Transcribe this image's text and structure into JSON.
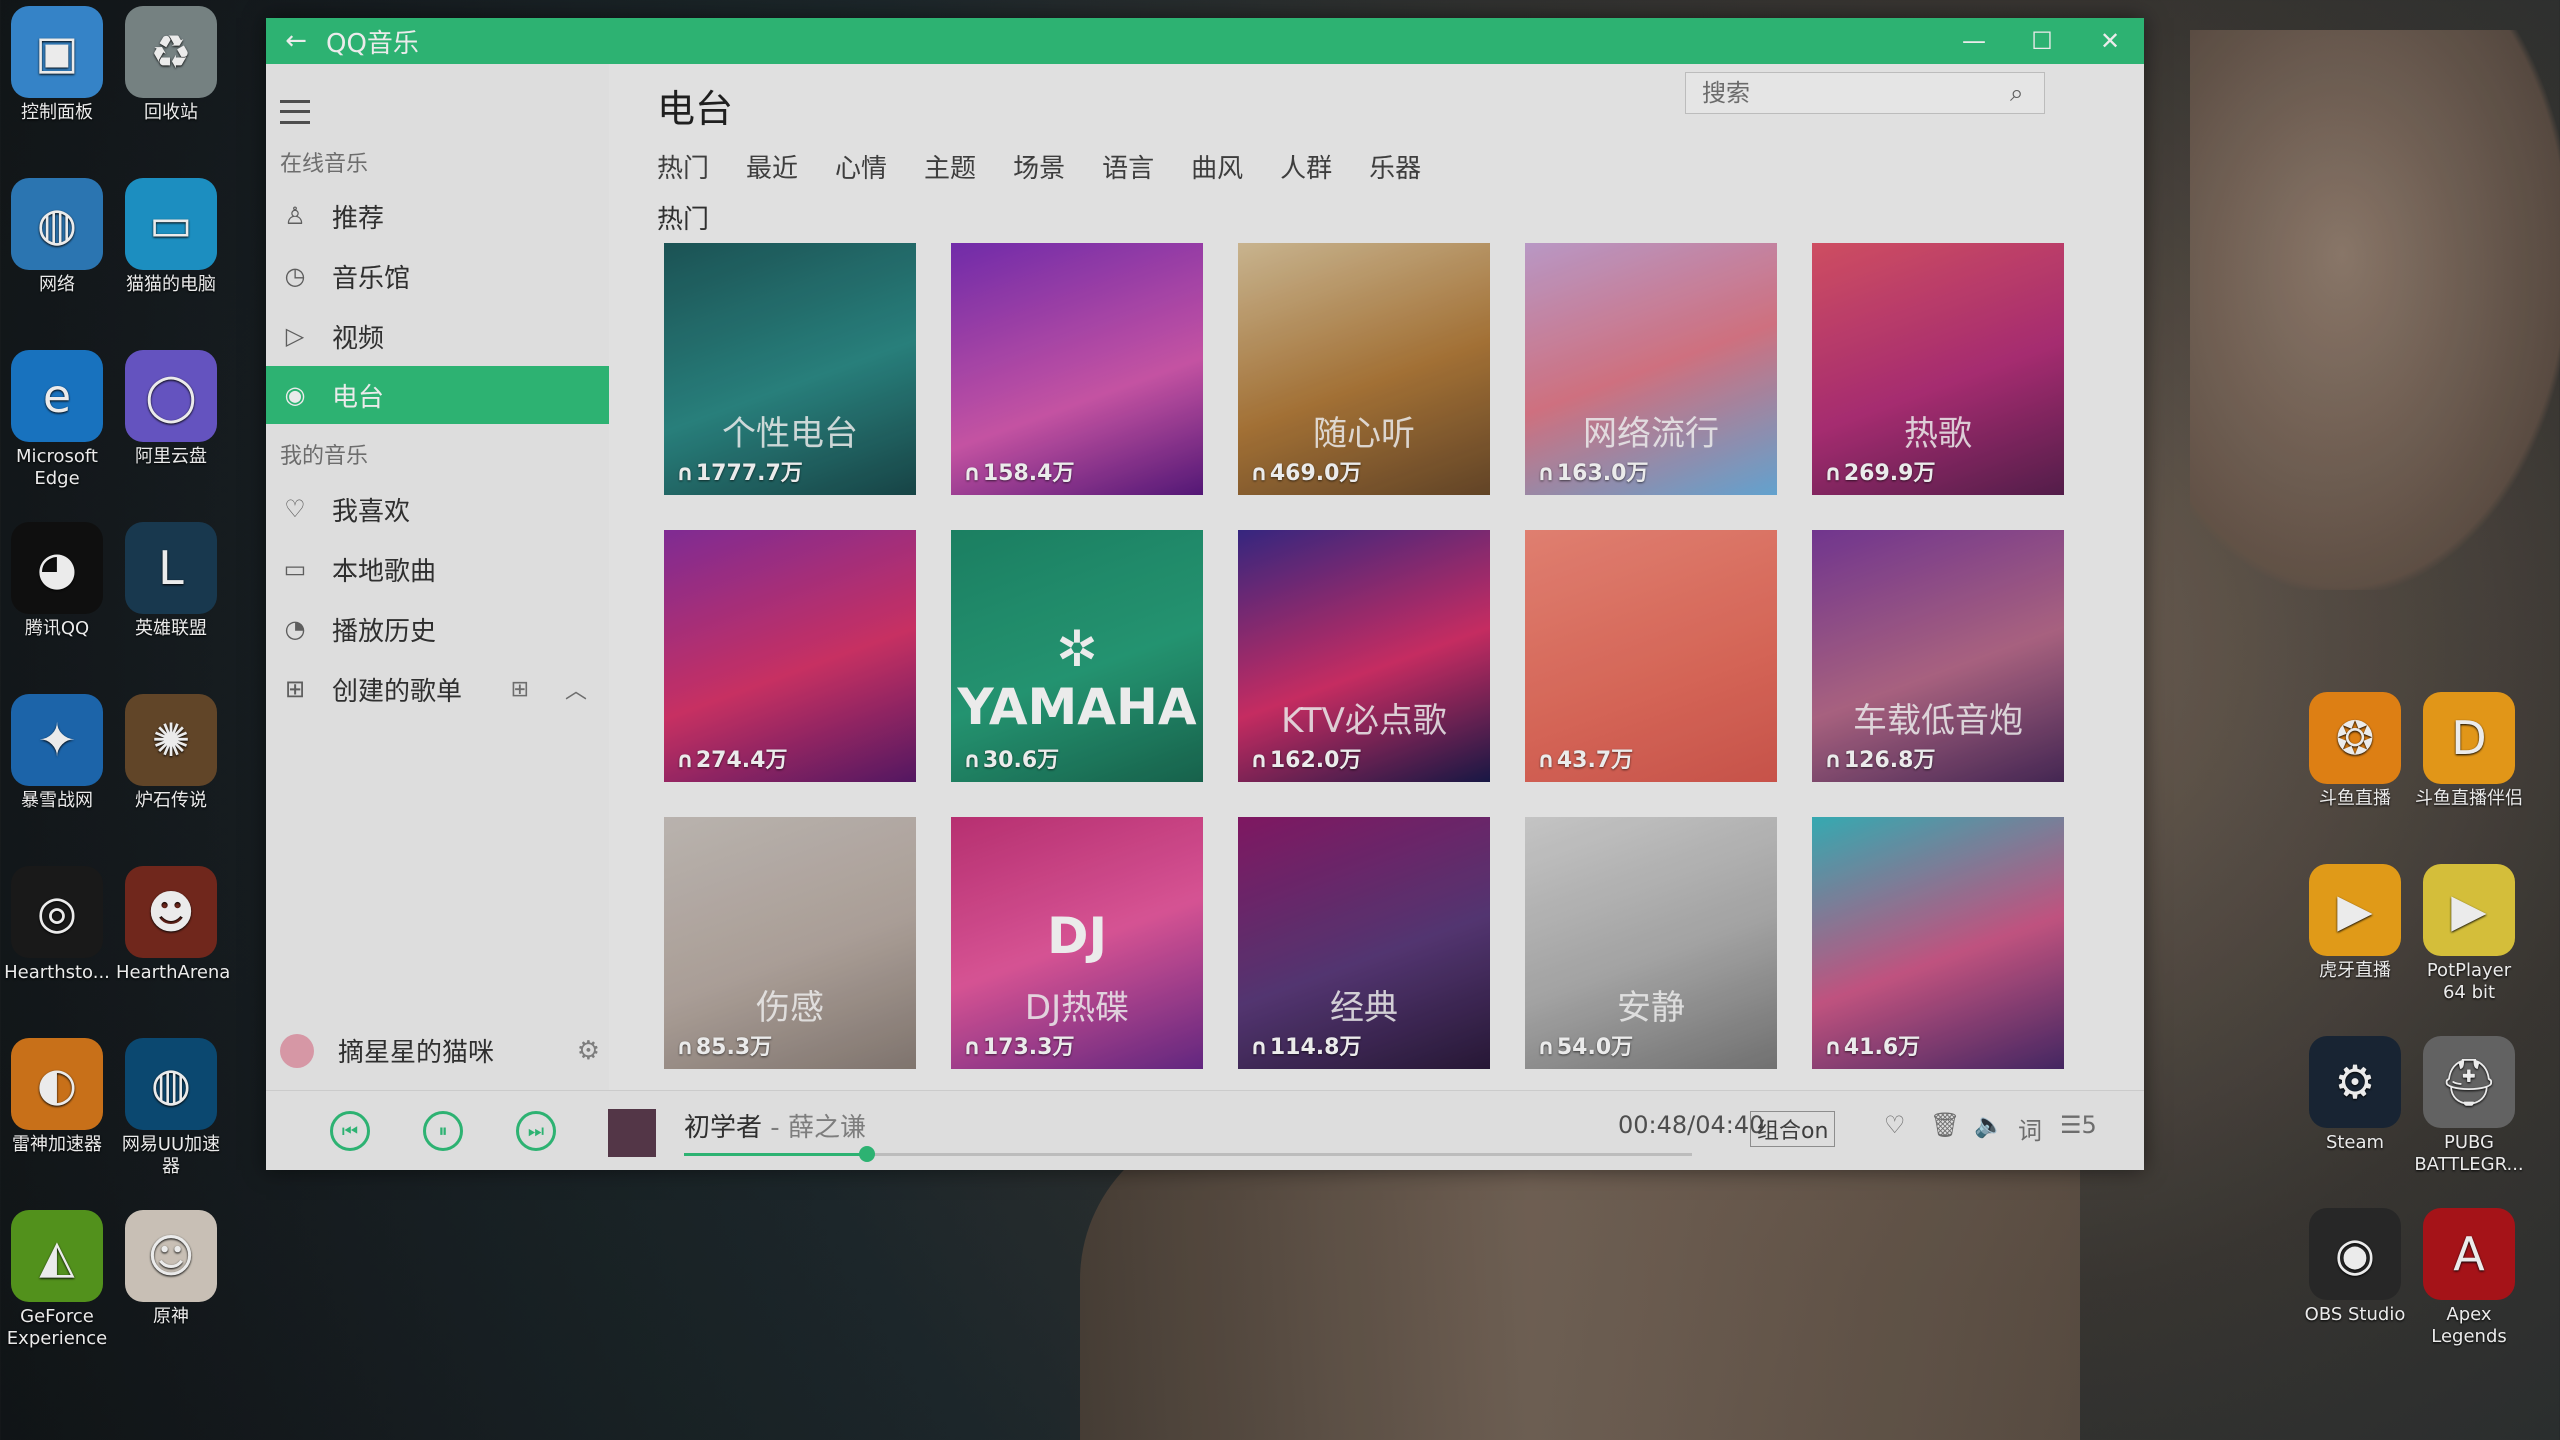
{
  "desktop": {
    "left_icons": [
      {
        "label": "控制面板",
        "color": "#3a8fd8",
        "glyph": "▣"
      },
      {
        "label": "回收站",
        "color": "#7f8c8d",
        "glyph": "♻"
      },
      {
        "label": "网络",
        "color": "#2f7fc1",
        "glyph": "◍"
      },
      {
        "label": "猫猫的电脑",
        "color": "#1f9bd1",
        "glyph": "▭"
      },
      {
        "label": "Microsoft Edge",
        "color": "#1b7ccf",
        "glyph": "e"
      },
      {
        "label": "阿里云盘",
        "color": "#6d5bd0",
        "glyph": "◯"
      },
      {
        "label": "腾讯QQ",
        "color": "#111111",
        "glyph": "◕"
      },
      {
        "label": "英雄联盟",
        "color": "#1b3d55",
        "glyph": "L"
      },
      {
        "label": "暴雪战网",
        "color": "#1f6db8",
        "glyph": "✦"
      },
      {
        "label": "炉石传说",
        "color": "#6a4b2c",
        "glyph": "✺"
      },
      {
        "label": "Hearthsto...",
        "color": "#1c1c1c",
        "glyph": "◎"
      },
      {
        "label": "HearthArena",
        "color": "#7a2b1f",
        "glyph": "☻"
      },
      {
        "label": "雷神加速器",
        "color": "#d97a1c",
        "glyph": "◐"
      },
      {
        "label": "网易UU加速器",
        "color": "#0d4f7a",
        "glyph": "◍"
      },
      {
        "label": "GeForce Experience",
        "color": "#5a9e1f",
        "glyph": "◭"
      },
      {
        "label": "原神",
        "color": "#d9d0c5",
        "glyph": "☺"
      }
    ],
    "right_icons": [
      {
        "label": "斗鱼直播",
        "color": "#f08a16",
        "glyph": "❂"
      },
      {
        "label": "斗鱼直播伴侣",
        "color": "#f5a31b",
        "glyph": "D"
      },
      {
        "label": "虎牙直播",
        "color": "#f3a81b",
        "glyph": "▶"
      },
      {
        "label": "PotPlayer 64 bit",
        "color": "#e6cf3f",
        "glyph": "▶"
      },
      {
        "label": "Steam",
        "color": "#1b2838",
        "glyph": "⚙"
      },
      {
        "label": "PUBG BATTLEGR...",
        "color": "#6b6b6b",
        "glyph": "⛑"
      },
      {
        "label": "OBS Studio",
        "color": "#2b2b2b",
        "glyph": "◉"
      },
      {
        "label": "Apex Legends",
        "color": "#b3151b",
        "glyph": "A"
      }
    ]
  },
  "window": {
    "title": "QQ音乐",
    "back_glyph": "←",
    "min_glyph": "—",
    "max_glyph": "☐",
    "close_glyph": "✕"
  },
  "sidebar": {
    "online_section": "在线音乐",
    "online_items": [
      {
        "label": "推荐",
        "glyph": "♙"
      },
      {
        "label": "音乐馆",
        "glyph": "◷"
      },
      {
        "label": "视频",
        "glyph": "▷"
      },
      {
        "label": "电台",
        "glyph": "◉"
      }
    ],
    "my_section": "我的音乐",
    "my_items": [
      {
        "label": "我喜欢",
        "glyph": "♡"
      },
      {
        "label": "本地歌曲",
        "glyph": "▭"
      },
      {
        "label": "播放历史",
        "glyph": "◔"
      },
      {
        "label": "创建的歌单",
        "glyph": "⊞"
      }
    ],
    "add_glyph": "⊞",
    "collapse_glyph": "︿",
    "user_name": "摘星星的猫咪",
    "settings_glyph": "⚙"
  },
  "main": {
    "page_title": "电台",
    "search_placeholder": "搜索",
    "search_glyph": "⌕",
    "tabs": [
      "热门",
      "最近",
      "心情",
      "主题",
      "场景",
      "语言",
      "曲风",
      "人群",
      "乐器"
    ],
    "section_label": "热门",
    "cards": [
      {
        "name": "个性电台",
        "count": "1777.7万",
        "bg": "linear-gradient(160deg,#1e5a5c,#2c8a86 55%,#1a4a4c)"
      },
      {
        "name": "",
        "count": "158.4万",
        "bg": "linear-gradient(160deg,#7a2fb8,#d55ab0 60%,#5a1a80)"
      },
      {
        "name": "随心听",
        "count": "469.0万",
        "bg": "linear-gradient(160deg,#d9c39b,#b07a3a 55%,#6a4a2a)"
      },
      {
        "name": "网络流行",
        "count": "163.0万",
        "bg": "linear-gradient(160deg,#c8a5d6,#e07a8a 50%,#6bb0e0)"
      },
      {
        "name": "热歌",
        "count": "269.9万",
        "bg": "linear-gradient(160deg,#e0556a,#b4307a 55%,#5a2050)"
      },
      {
        "name": "",
        "count": "274.4万",
        "bg": "linear-gradient(160deg,#8a2fa0,#d8356b 55%,#5a1a6a)"
      },
      {
        "name": "",
        "count": "30.6万",
        "bg": "linear-gradient(160deg,#1e8a6a,#27a07a 55%,#1a6a52)",
        "big": "✲ YAMAHA"
      },
      {
        "name": "KTV必点歌",
        "count": "162.0万",
        "bg": "linear-gradient(160deg,#3a2a8a,#d6306a 55%,#1a1a4a)"
      },
      {
        "name": "",
        "count": "43.7万",
        "bg": "linear-gradient(160deg,#f28a7a,#e87060 55%,#d85a50)"
      },
      {
        "name": "车载低音炮",
        "count": "126.8万",
        "bg": "linear-gradient(160deg,#7a3a9a,#b66a8a 55%,#4a2a5a)"
      },
      {
        "name": "伤感",
        "count": "85.3万",
        "bg": "linear-gradient(160deg,#c9c2bd,#b8aba3 55%,#8a7e77)"
      },
      {
        "name": "DJ热碟",
        "count": "173.3万",
        "bg": "linear-gradient(160deg,#c6347a,#e85aa0 50%,#6a2a8a)",
        "big": "DJ"
      },
      {
        "name": "经典",
        "count": "114.8万",
        "bg": "linear-gradient(160deg,#8a1a6a,#5a3a7a 55%,#2a1a3a)"
      },
      {
        "name": "安静",
        "count": "54.0万",
        "bg": "linear-gradient(160deg,#d5d5d5,#b0b0b0 55%,#7a7a7a)"
      },
      {
        "name": "",
        "count": "41.6万",
        "bg": "linear-gradient(160deg,#3ab8c0,#d05a8a 55%,#4a2a6a)"
      }
    ]
  },
  "player": {
    "prev_glyph": "⏮",
    "pause_glyph": "⏸",
    "next_glyph": "⏭",
    "song": "初学者",
    "separator": " - ",
    "artist": "薛之谦",
    "progress": 0.182,
    "time": "00:48/04:40",
    "mode": "组合on",
    "like_glyph": "♡",
    "delete_glyph": "🗑",
    "volume_glyph": "🔈",
    "lyrics": "词",
    "playlist": "☰5"
  }
}
